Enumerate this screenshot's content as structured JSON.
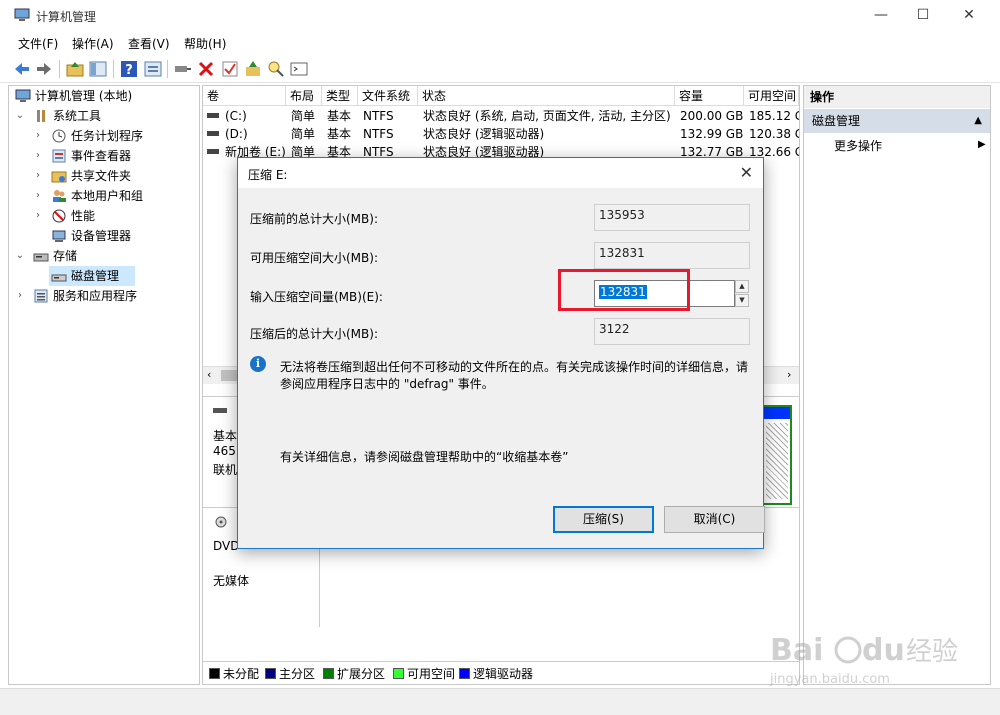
{
  "window": {
    "title": "计算机管理",
    "buttons": {
      "minimize": "—",
      "maximize": "☐",
      "close": "✕"
    }
  },
  "menu": [
    "文件(F)",
    "操作(A)",
    "查看(V)",
    "帮助(H)"
  ],
  "tree": {
    "root": "计算机管理 (本地)",
    "items": [
      {
        "label": "系统工具",
        "icon": "tools-icon"
      },
      {
        "label": "任务计划程序",
        "icon": "clock-icon"
      },
      {
        "label": "事件查看器",
        "icon": "event-viewer-icon"
      },
      {
        "label": "共享文件夹",
        "icon": "shared-folder-icon"
      },
      {
        "label": "本地用户和组",
        "icon": "users-icon"
      },
      {
        "label": "性能",
        "icon": "performance-icon"
      },
      {
        "label": "设备管理器",
        "icon": "device-manager-icon"
      },
      {
        "label": "存储",
        "icon": "storage-icon"
      },
      {
        "label": "磁盘管理",
        "icon": "disk-icon"
      },
      {
        "label": "服务和应用程序",
        "icon": "services-icon"
      }
    ]
  },
  "volumes": {
    "headers": [
      "卷",
      "布局",
      "类型",
      "文件系统",
      "状态",
      "容量",
      "可用空间"
    ],
    "rows": [
      [
        "(C:)",
        "简单",
        "基本",
        "NTFS",
        "状态良好 (系统, 启动, 页面文件, 活动, 主分区)",
        "200.00 GB",
        "185.12 G"
      ],
      [
        "(D:)",
        "简单",
        "基本",
        "NTFS",
        "状态良好 (逻辑驱动器)",
        "132.99 GB",
        "120.38 G"
      ],
      [
        "新加卷 (E:)",
        "简单",
        "基本",
        "NTFS",
        "状态良好 (逻辑驱动器)",
        "132.77 GB",
        "132.66 G"
      ]
    ]
  },
  "disk_area": {
    "disk0": {
      "line1": "基本",
      "line2": "465.",
      "line3": "联机"
    },
    "cd": {
      "line1": "DVD",
      "line2": "无媒体"
    }
  },
  "legend": [
    {
      "label": "未分配",
      "color": "#000000"
    },
    {
      "label": "主分区",
      "color": "#000080"
    },
    {
      "label": "扩展分区",
      "color": "#008000"
    },
    {
      "label": "可用空间",
      "color": "#33ff33"
    },
    {
      "label": "逻辑驱动器",
      "color": "#0000ff"
    }
  ],
  "actions": {
    "header": "操作",
    "section": "磁盘管理",
    "item": "更多操作"
  },
  "dialog": {
    "title": "压缩 E:",
    "total_before_label": "压缩前的总计大小(MB):",
    "total_before_value": "135953",
    "available_label": "可用压缩空间大小(MB):",
    "available_value": "132831",
    "input_label": "输入压缩空间量(MB)(E):",
    "input_value": "132831",
    "total_after_label": "压缩后的总计大小(MB):",
    "total_after_value": "3122",
    "info_text_1": "无法将卷压缩到超出任何不可移动的文件所在的点。有关完成该操作时间的详细信息，请",
    "info_text_2": "参阅应用程序日志中的 \"defrag\" 事件。",
    "help_text": "有关详细信息，请参阅磁盘管理帮助中的“收缩基本卷”",
    "shrink_button": "压缩(S)",
    "cancel_button": "取消(C)"
  },
  "watermark": {
    "brand": "Bai du 经验",
    "url": "jingyan.baidu.com"
  }
}
